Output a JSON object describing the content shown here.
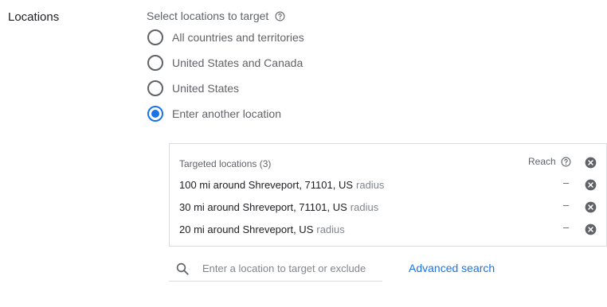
{
  "section": {
    "label": "Locations"
  },
  "targeting": {
    "heading": "Select locations to target",
    "help_icon": "help-circle-icon",
    "options": [
      {
        "label": "All countries and territories",
        "checked": false
      },
      {
        "label": "United States and Canada",
        "checked": false
      },
      {
        "label": "United States",
        "checked": false
      },
      {
        "label": "Enter another location",
        "checked": true
      }
    ]
  },
  "targeted": {
    "title": "Targeted locations (3)",
    "reach_label": "Reach",
    "remove_icon": "close-circle-icon",
    "locations": [
      {
        "text": "100 mi around Shreveport, 71101, US",
        "type": "radius",
        "reach": "–"
      },
      {
        "text": "30 mi around Shreveport, 71101, US",
        "type": "radius",
        "reach": "–"
      },
      {
        "text": "20 mi around Shreveport, US",
        "type": "radius",
        "reach": "–"
      }
    ]
  },
  "search": {
    "icon": "search-icon",
    "placeholder": "Enter a location to target or exclude",
    "value": ""
  },
  "advanced_search": {
    "label": "Advanced search"
  },
  "colors": {
    "accent": "#1a73e8",
    "text": "#202124",
    "secondary": "#5f6368",
    "border": "#dadce0"
  }
}
